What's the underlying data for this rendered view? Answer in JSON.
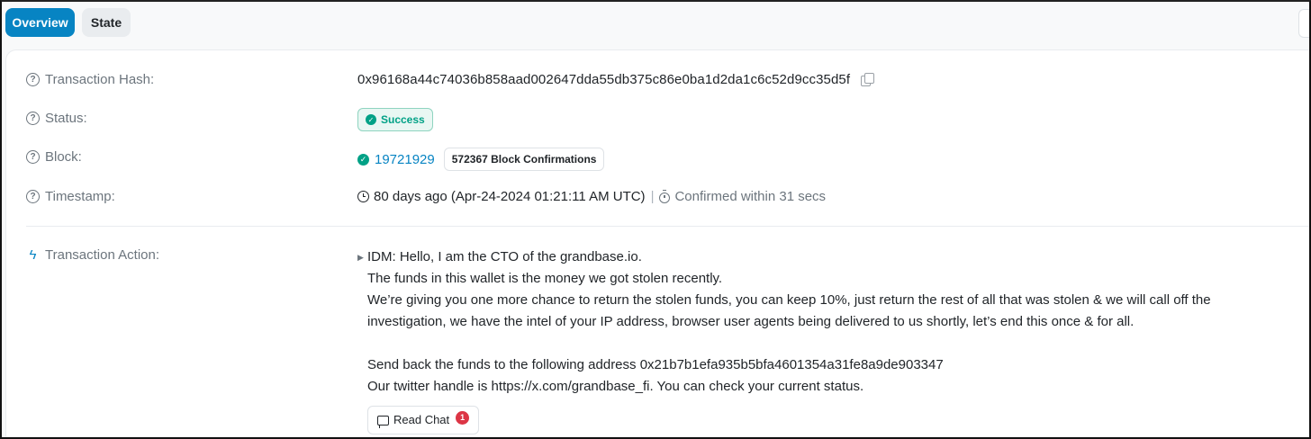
{
  "tabs": [
    {
      "label": "Overview",
      "active": true
    },
    {
      "label": "State",
      "active": false
    }
  ],
  "fields": {
    "hash": {
      "label": "Transaction Hash:",
      "value": "0x96168a44c74036b858aad002647dda55db375c86e0ba1d2da1c6c52d9cc35d5f"
    },
    "status": {
      "label": "Status:",
      "value": "Success"
    },
    "block": {
      "label": "Block:",
      "value": "19721929",
      "confirmations": "572367 Block Confirmations"
    },
    "timestamp": {
      "label": "Timestamp:",
      "value": "80 days ago (Apr-24-2024 01:21:11 AM UTC)",
      "separator": "|",
      "confirmed": "Confirmed within 31 secs"
    }
  },
  "action": {
    "label": "Transaction Action:",
    "lines": [
      "IDM: Hello, I am the CTO of the grandbase.io.",
      "The funds in this wallet is the money we got stolen recently.",
      "We’re giving you one more chance to return the stolen funds, you can keep 10%, just return the rest of all that was stolen & we will call off the",
      "investigation, we have the intel of your IP address, browser user agents being delivered to us shortly, let’s end this once & for all.",
      "Send back the funds to the following address 0x21b7b1efa935b5bfa4601354a31fe8a9de903347",
      "Our twitter handle is https://x.com/grandbase_fi. You can check your current status."
    ],
    "read_chat_label": "Read Chat",
    "unread_count": "1"
  },
  "colors": {
    "accent": "#0784c3",
    "success": "#00a186",
    "danger": "#dc3545"
  }
}
